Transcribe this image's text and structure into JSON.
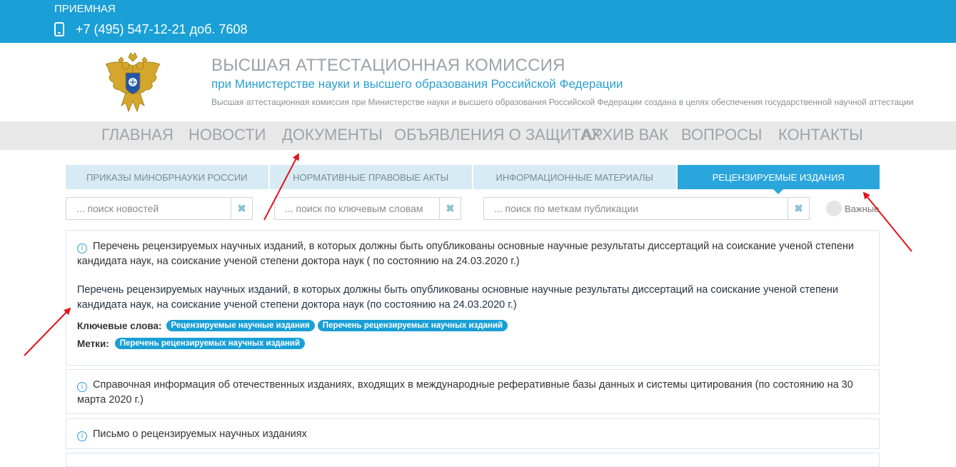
{
  "topbar": {
    "reception": "ПРИЕМНАЯ",
    "phone": "+7 (495) 547-12-21 доб. 7608"
  },
  "header": {
    "title": "ВЫСШАЯ АТТЕСТАЦИОННАЯ КОМИССИЯ",
    "subtitle": "при Министерстве науки и высшего образования Российской Федерации",
    "description": "Высшая аттестационная комиссия при Министерстве науки и высшего образования Российской Федерации создана в целях обеспечения государственной научной аттестации"
  },
  "nav": {
    "items": [
      {
        "label": "ГЛАВНАЯ"
      },
      {
        "label": "НОВОСТИ"
      },
      {
        "label": "ДОКУМЕНТЫ"
      },
      {
        "label": "ОБЪЯВЛЕНИЯ О ЗАЩИТАХ"
      },
      {
        "label": "АРХИВ ВАК"
      },
      {
        "label": "ВОПРОСЫ"
      },
      {
        "label": "КОНТАКТЫ"
      }
    ]
  },
  "tabs": [
    {
      "label": "ПРИКАЗЫ МИНОБРНАУКИ РОССИИ",
      "active": false
    },
    {
      "label": "НОРМАТИВНЫЕ ПРАВОВЫЕ АКТЫ",
      "active": false
    },
    {
      "label": "ИНФОРМАЦИОННЫЕ МАТЕРИАЛЫ",
      "active": false
    },
    {
      "label": "РЕЦЕНЗИРУЕМЫЕ ИЗДАНИЯ",
      "active": true
    }
  ],
  "filters": {
    "news_placeholder": "... поиск новостей",
    "keywords_placeholder": "... поиск по ключевым словам",
    "tags_placeholder": "... поиск по меткам публикации",
    "clear_symbol": "✖",
    "important_label": "Важные"
  },
  "documents": [
    {
      "title": "Перечень рецензируемых научных изданий, в которых должны быть опубликованы основные научные результаты диссертаций на соискание ученой степени кандидата наук, на соискание ученой степени доктора наук ( по состоянию на 24.03.2020 г.)",
      "body": "Перечень рецензируемых научных изданий, в которых должны быть опубликованы основные научные результаты диссертаций на соискание ученой степени кандидата наук, на соискание ученой степени доктора наук  (по состоянию на 24.03.2020 г.)",
      "keywords_label": "Ключевые слова:",
      "keywords": [
        "Рецензируемые научные издания",
        "Перечень рецензируемых научных изданий"
      ],
      "tags_label": "Метки:",
      "tags": [
        "Перечень рецензируемых научных изданий"
      ]
    },
    {
      "title": "Справочная информация об отечественных изданиях, входящих в международные реферативные базы данных и системы цитирования (по состоянию на 30 марта 2020 г.)"
    },
    {
      "title": "Письмо о рецензируемых научных изданиях"
    }
  ],
  "info_symbol": "i",
  "colors": {
    "brand_blue": "#1a9fd6",
    "annotation_red": "#e3141b"
  },
  "icons": {
    "phone": "phone-icon",
    "emblem": "coat-of-arms-emblem",
    "info": "info-icon",
    "clear": "clear-icon"
  }
}
